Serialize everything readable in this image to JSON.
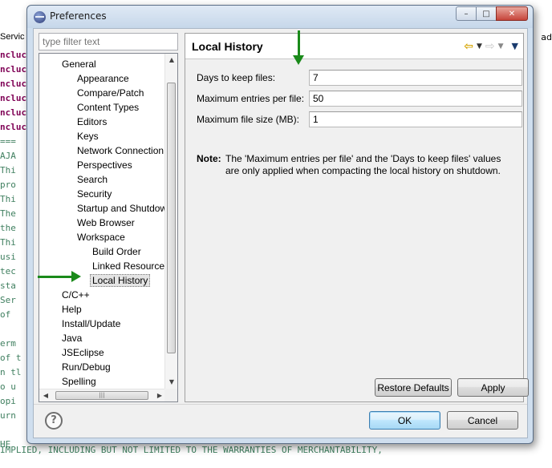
{
  "background": {
    "left_lines": [
      "ncluc",
      "ncluc",
      "ncluc",
      "ncluc",
      "ncluc",
      "ncluc",
      "===",
      "AJA",
      "Thi",
      "pro",
      "Thi",
      "The",
      "the",
      "Thi",
      "usi",
      "tec",
      "sta",
      "Ser",
      "of",
      "",
      "erm",
      "of t",
      "n tl",
      "o u",
      "opi",
      "urn",
      "",
      "HE"
    ],
    "right_fragment": "ad",
    "top_fragment": "Servic",
    "bottom_line": "IMPLIED, INCLUDING BUT NOT LIMITED TO THE WARRANTIES OF MERCHANTABILITY,"
  },
  "window": {
    "title": "Preferences",
    "buttons": {
      "minimize": "–",
      "maximize": "□",
      "close": "✕"
    }
  },
  "filter": {
    "placeholder": "type filter text"
  },
  "tree": {
    "items": [
      {
        "label": "General",
        "level": 1
      },
      {
        "label": "Appearance",
        "level": 2
      },
      {
        "label": "Compare/Patch",
        "level": 2
      },
      {
        "label": "Content Types",
        "level": 2
      },
      {
        "label": "Editors",
        "level": 2
      },
      {
        "label": "Keys",
        "level": 2
      },
      {
        "label": "Network Connection",
        "level": 2
      },
      {
        "label": "Perspectives",
        "level": 2
      },
      {
        "label": "Search",
        "level": 2
      },
      {
        "label": "Security",
        "level": 2
      },
      {
        "label": "Startup and Shutdown",
        "level": 2
      },
      {
        "label": "Web Browser",
        "level": 2
      },
      {
        "label": "Workspace",
        "level": 2
      },
      {
        "label": "Build Order",
        "level": 3
      },
      {
        "label": "Linked Resources",
        "level": 3
      },
      {
        "label": "Local History",
        "level": 3,
        "selected": true
      },
      {
        "label": "C/C++",
        "level": 1
      },
      {
        "label": "Help",
        "level": 1
      },
      {
        "label": "Install/Update",
        "level": 1
      },
      {
        "label": "Java",
        "level": 1
      },
      {
        "label": "JSEclipse",
        "level": 1
      },
      {
        "label": "Run/Debug",
        "level": 1
      },
      {
        "label": "Spelling",
        "level": 1
      }
    ]
  },
  "page": {
    "title": "Local History",
    "fields": [
      {
        "label": "Days to keep files:",
        "value": "7"
      },
      {
        "label": "Maximum entries per file:",
        "value": "50"
      },
      {
        "label": "Maximum file size (MB):",
        "value": "1"
      }
    ],
    "note_label": "Note:",
    "note_text": "The 'Maximum entries per file' and the 'Days to keep files' values are only applied when compacting the local history on shutdown.",
    "restore_defaults": "Restore Defaults",
    "apply": "Apply"
  },
  "footer": {
    "help": "?",
    "ok": "OK",
    "cancel": "Cancel"
  },
  "colors": {
    "annotation_arrow": "#1a8a1a",
    "background_code_purple": "#7f0055",
    "background_code_green": "#3f7f5f"
  }
}
